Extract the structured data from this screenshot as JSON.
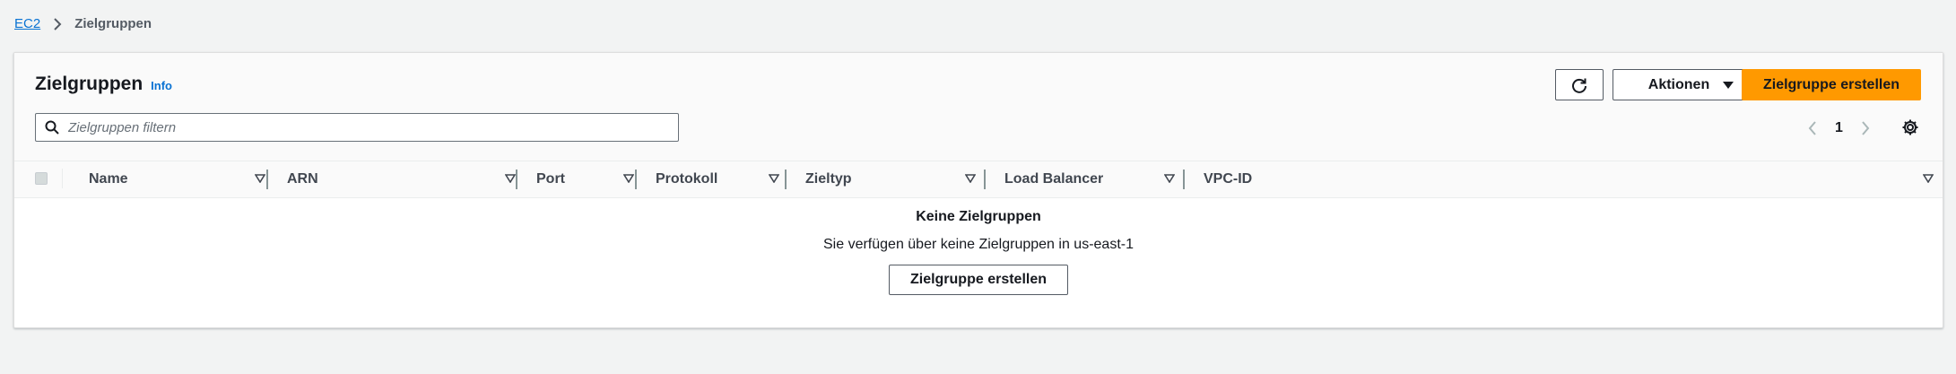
{
  "breadcrumb": {
    "root": "EC2",
    "current": "Zielgruppen"
  },
  "header": {
    "title": "Zielgruppen",
    "info": "Info",
    "actions_label": "Aktionen",
    "create_label": "Zielgruppe erstellen"
  },
  "filter": {
    "placeholder": "Zielgruppen filtern",
    "value": ""
  },
  "pagination": {
    "current_page": "1"
  },
  "table": {
    "columns": [
      "Name",
      "ARN",
      "Port",
      "Protokoll",
      "Zieltyp",
      "Load Balancer",
      "VPC-ID"
    ]
  },
  "empty_state": {
    "title": "Keine Zielgruppen",
    "description": "Sie verfügen über keine Zielgruppen in us-east-1",
    "button_label": "Zielgruppe erstellen"
  },
  "colors": {
    "primary_button": "#ff9900",
    "link": "#0972d3",
    "background": "#f2f3f3"
  }
}
